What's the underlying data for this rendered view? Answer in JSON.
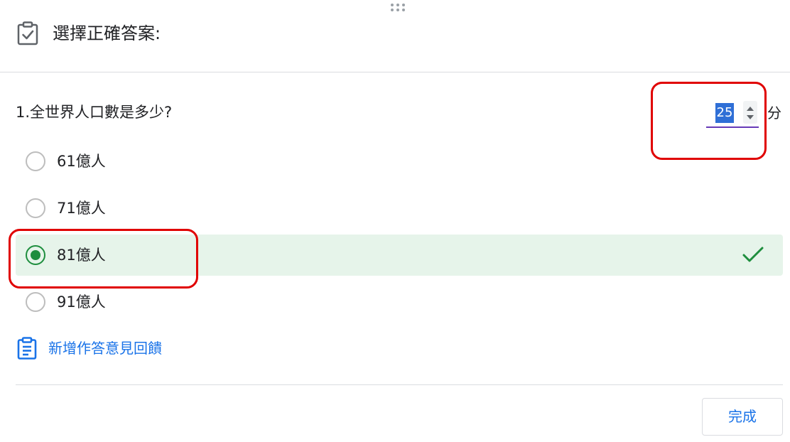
{
  "header": {
    "title": "選擇正確答案:",
    "icon": "assignment-check-icon"
  },
  "question": {
    "text": "1.全世界人口數是多少?",
    "points_value": "25",
    "points_unit": "分"
  },
  "options": [
    {
      "label": "61億人",
      "selected": false,
      "correct": false
    },
    {
      "label": "71億人",
      "selected": false,
      "correct": false
    },
    {
      "label": "81億人",
      "selected": true,
      "correct": true
    },
    {
      "label": "91億人",
      "selected": false,
      "correct": false
    }
  ],
  "feedback": {
    "label": "新增作答意見回饋",
    "icon": "feedback-clipboard-icon"
  },
  "footer": {
    "done_label": "完成"
  },
  "colors": {
    "accent": "#1a73e8",
    "correct_green": "#1e8e3e",
    "selected_bg": "#e6f4ea",
    "focus_underline": "#673ab7",
    "annotation_red": "#e00000"
  }
}
